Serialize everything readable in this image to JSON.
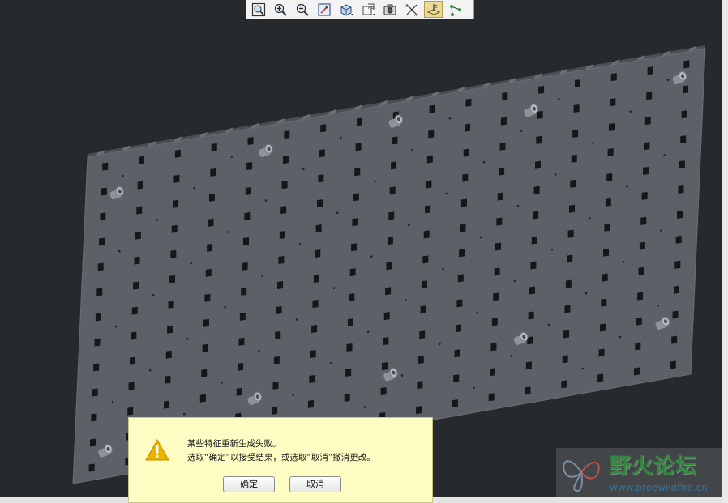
{
  "toolbar": {
    "buttons": [
      {
        "name": "zoom-fit",
        "icon": "zoom-fit-icon"
      },
      {
        "name": "zoom-in",
        "icon": "zoom-in-icon"
      },
      {
        "name": "zoom-out",
        "icon": "zoom-out-icon"
      },
      {
        "name": "repaint",
        "icon": "repaint-icon"
      },
      {
        "name": "display-style",
        "icon": "shaded-cube-icon"
      },
      {
        "name": "saved-views",
        "icon": "saved-views-icon"
      },
      {
        "name": "view-manager",
        "icon": "camera-icon"
      },
      {
        "name": "datum-axes",
        "icon": "axes-icon"
      },
      {
        "name": "datum-display",
        "icon": "datum-planes-icon",
        "active": true
      },
      {
        "name": "datum-points",
        "icon": "points-icon"
      }
    ]
  },
  "dialog": {
    "line1": "某些特征重新生成失败。",
    "line2": "选取“确定”以接受结果，或选取“取消”撤消更改。",
    "ok_label": "确定",
    "cancel_label": "取消",
    "icon": "warning-icon"
  },
  "watermark": {
    "title": "野火论坛",
    "url": "www.proewildfire.cn"
  },
  "colors": {
    "background": "#272a2d",
    "plate": "#5d6167",
    "plate_shadow": "#4b4f55",
    "dialog_bg": "#fdfcc2",
    "warning": "#e8b400",
    "watermark_green": "#2d8a3b"
  },
  "model": {
    "description_visible": false,
    "hole_grid": {
      "columns": 17,
      "rows": 13
    },
    "boss_count": 10
  }
}
